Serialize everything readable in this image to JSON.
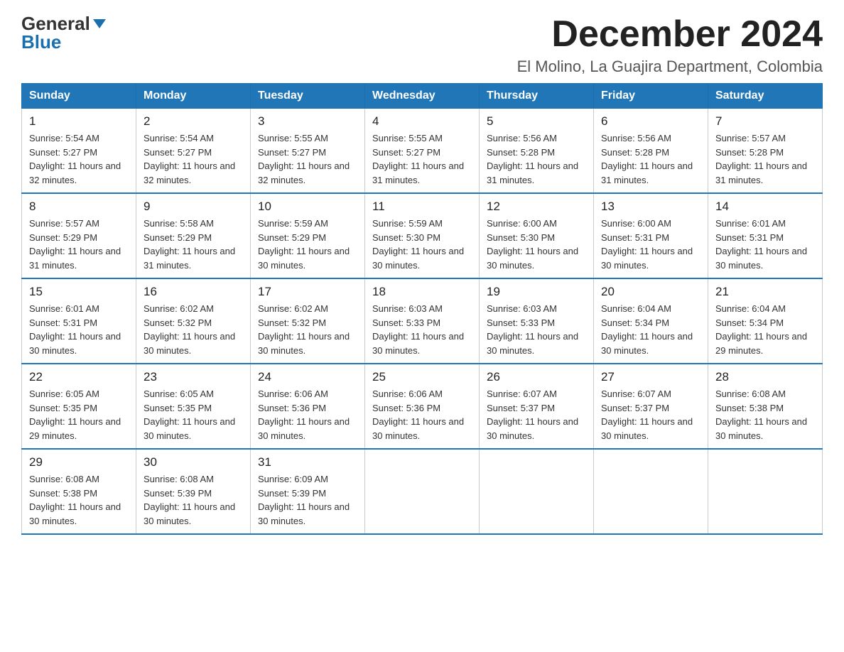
{
  "logo": {
    "top_text": "General",
    "bottom_text": "Blue"
  },
  "title": "December 2024",
  "subtitle": "El Molino, La Guajira Department, Colombia",
  "days_of_week": [
    "Sunday",
    "Monday",
    "Tuesday",
    "Wednesday",
    "Thursday",
    "Friday",
    "Saturday"
  ],
  "weeks": [
    [
      {
        "day": "1",
        "sunrise": "5:54 AM",
        "sunset": "5:27 PM",
        "daylight": "11 hours and 32 minutes."
      },
      {
        "day": "2",
        "sunrise": "5:54 AM",
        "sunset": "5:27 PM",
        "daylight": "11 hours and 32 minutes."
      },
      {
        "day": "3",
        "sunrise": "5:55 AM",
        "sunset": "5:27 PM",
        "daylight": "11 hours and 32 minutes."
      },
      {
        "day": "4",
        "sunrise": "5:55 AM",
        "sunset": "5:27 PM",
        "daylight": "11 hours and 31 minutes."
      },
      {
        "day": "5",
        "sunrise": "5:56 AM",
        "sunset": "5:28 PM",
        "daylight": "11 hours and 31 minutes."
      },
      {
        "day": "6",
        "sunrise": "5:56 AM",
        "sunset": "5:28 PM",
        "daylight": "11 hours and 31 minutes."
      },
      {
        "day": "7",
        "sunrise": "5:57 AM",
        "sunset": "5:28 PM",
        "daylight": "11 hours and 31 minutes."
      }
    ],
    [
      {
        "day": "8",
        "sunrise": "5:57 AM",
        "sunset": "5:29 PM",
        "daylight": "11 hours and 31 minutes."
      },
      {
        "day": "9",
        "sunrise": "5:58 AM",
        "sunset": "5:29 PM",
        "daylight": "11 hours and 31 minutes."
      },
      {
        "day": "10",
        "sunrise": "5:59 AM",
        "sunset": "5:29 PM",
        "daylight": "11 hours and 30 minutes."
      },
      {
        "day": "11",
        "sunrise": "5:59 AM",
        "sunset": "5:30 PM",
        "daylight": "11 hours and 30 minutes."
      },
      {
        "day": "12",
        "sunrise": "6:00 AM",
        "sunset": "5:30 PM",
        "daylight": "11 hours and 30 minutes."
      },
      {
        "day": "13",
        "sunrise": "6:00 AM",
        "sunset": "5:31 PM",
        "daylight": "11 hours and 30 minutes."
      },
      {
        "day": "14",
        "sunrise": "6:01 AM",
        "sunset": "5:31 PM",
        "daylight": "11 hours and 30 minutes."
      }
    ],
    [
      {
        "day": "15",
        "sunrise": "6:01 AM",
        "sunset": "5:31 PM",
        "daylight": "11 hours and 30 minutes."
      },
      {
        "day": "16",
        "sunrise": "6:02 AM",
        "sunset": "5:32 PM",
        "daylight": "11 hours and 30 minutes."
      },
      {
        "day": "17",
        "sunrise": "6:02 AM",
        "sunset": "5:32 PM",
        "daylight": "11 hours and 30 minutes."
      },
      {
        "day": "18",
        "sunrise": "6:03 AM",
        "sunset": "5:33 PM",
        "daylight": "11 hours and 30 minutes."
      },
      {
        "day": "19",
        "sunrise": "6:03 AM",
        "sunset": "5:33 PM",
        "daylight": "11 hours and 30 minutes."
      },
      {
        "day": "20",
        "sunrise": "6:04 AM",
        "sunset": "5:34 PM",
        "daylight": "11 hours and 30 minutes."
      },
      {
        "day": "21",
        "sunrise": "6:04 AM",
        "sunset": "5:34 PM",
        "daylight": "11 hours and 29 minutes."
      }
    ],
    [
      {
        "day": "22",
        "sunrise": "6:05 AM",
        "sunset": "5:35 PM",
        "daylight": "11 hours and 29 minutes."
      },
      {
        "day": "23",
        "sunrise": "6:05 AM",
        "sunset": "5:35 PM",
        "daylight": "11 hours and 30 minutes."
      },
      {
        "day": "24",
        "sunrise": "6:06 AM",
        "sunset": "5:36 PM",
        "daylight": "11 hours and 30 minutes."
      },
      {
        "day": "25",
        "sunrise": "6:06 AM",
        "sunset": "5:36 PM",
        "daylight": "11 hours and 30 minutes."
      },
      {
        "day": "26",
        "sunrise": "6:07 AM",
        "sunset": "5:37 PM",
        "daylight": "11 hours and 30 minutes."
      },
      {
        "day": "27",
        "sunrise": "6:07 AM",
        "sunset": "5:37 PM",
        "daylight": "11 hours and 30 minutes."
      },
      {
        "day": "28",
        "sunrise": "6:08 AM",
        "sunset": "5:38 PM",
        "daylight": "11 hours and 30 minutes."
      }
    ],
    [
      {
        "day": "29",
        "sunrise": "6:08 AM",
        "sunset": "5:38 PM",
        "daylight": "11 hours and 30 minutes."
      },
      {
        "day": "30",
        "sunrise": "6:08 AM",
        "sunset": "5:39 PM",
        "daylight": "11 hours and 30 minutes."
      },
      {
        "day": "31",
        "sunrise": "6:09 AM",
        "sunset": "5:39 PM",
        "daylight": "11 hours and 30 minutes."
      },
      null,
      null,
      null,
      null
    ]
  ]
}
